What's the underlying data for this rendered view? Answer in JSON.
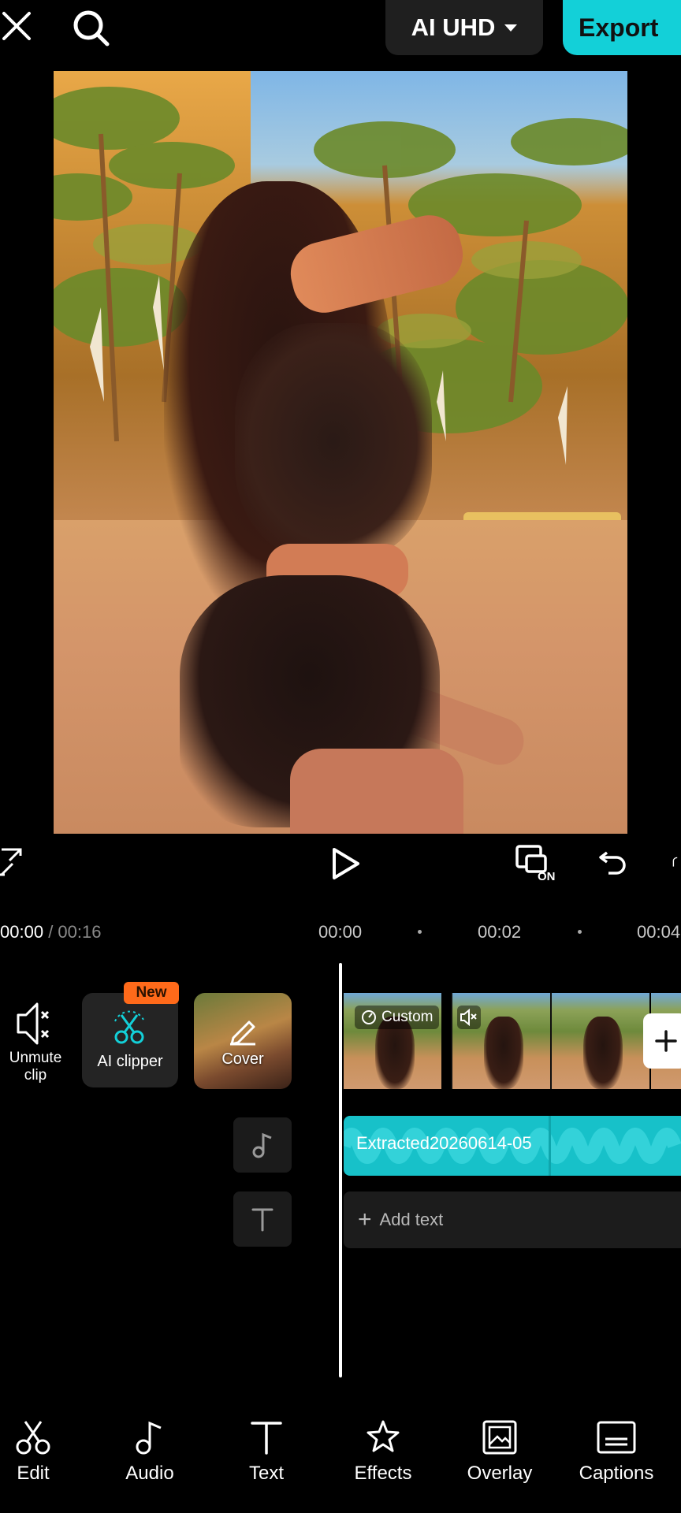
{
  "topbar": {
    "quality_label": "AI UHD",
    "export_label": "Export",
    "accent_color": "#13d0d8"
  },
  "player": {
    "current_time": "00:00",
    "total_time": "/ 00:16",
    "ticks": [
      "00:00",
      "00:02",
      "00:04"
    ],
    "keyframe_badge": "ON"
  },
  "timeline": {
    "tools": {
      "unmute_label": "Unmute clip",
      "aiclipper_label": "AI clipper",
      "aiclipper_badge": "New",
      "cover_label": "Cover"
    },
    "video_clip": {
      "speed_label": "Custom",
      "muted": true
    },
    "audio_clip": {
      "name": "Extracted20260614-05",
      "color": "#17c1c9"
    },
    "text_track": {
      "add_label": "Add text"
    }
  },
  "bottom_toolbar": {
    "items": [
      {
        "label": "Edit",
        "icon": "scissors-icon"
      },
      {
        "label": "Audio",
        "icon": "music-note-icon"
      },
      {
        "label": "Text",
        "icon": "text-icon"
      },
      {
        "label": "Effects",
        "icon": "star-icon"
      },
      {
        "label": "Overlay",
        "icon": "overlay-icon"
      },
      {
        "label": "Captions",
        "icon": "captions-icon"
      }
    ]
  }
}
